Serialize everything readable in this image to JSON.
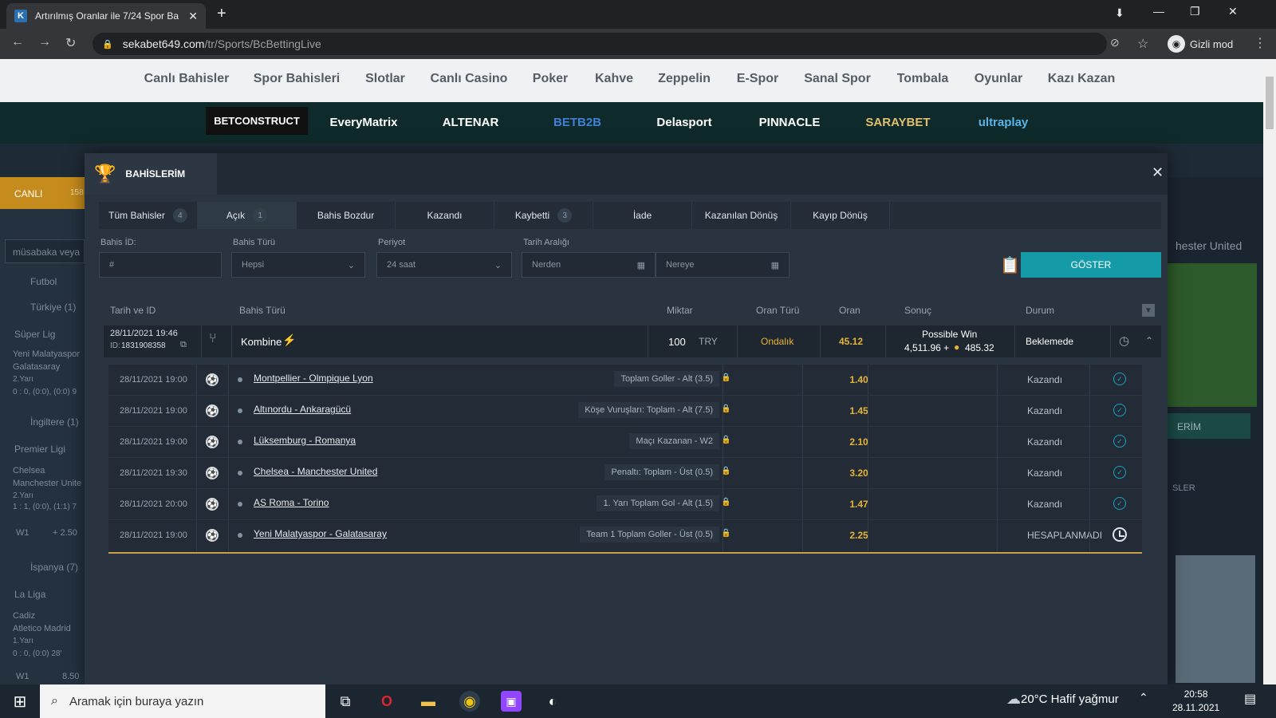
{
  "browser": {
    "tab_title": "Artırılmış Oranlar ile 7/24 Spor Ba",
    "url_domain": "sekabet649.com",
    "url_path": "/tr/Sports/BcBettingLive",
    "incognito_label": "Gizli mod"
  },
  "site_nav": [
    "Canlı Bahisler",
    "Spor Bahisleri",
    "Slotlar",
    "Canlı Casino",
    "Poker",
    "Kahve",
    "Zeppelin",
    "E-Spor",
    "Sanal Spor",
    "Tombala",
    "Oyunlar",
    "Kazı Kazan"
  ],
  "providers": [
    "BETCONSTRUCT",
    "EveryMatrix",
    "ALTENAR",
    "BETB2B",
    "Delasport",
    "PINNACLE",
    "SARAYBET",
    "ultraplay"
  ],
  "left_panel": {
    "live": "CANLI",
    "live_count": "158",
    "search_placeholder": "müsabaka veya",
    "football": "Futbol",
    "turkey": "Türkiye (1)",
    "super_lig": "Süper Lig",
    "m1a": "Yeni Malatyaspor",
    "m1b": "Galatasaray",
    "m1c": "2.Yarı",
    "m1d": "0 : 0, (0:0), (0:0) 9",
    "england": "İngiltere (1)",
    "premier": "Premier Ligi",
    "m2a": "Chelsea",
    "m2b": "Manchester Unite",
    "m2c": "2.Yarı",
    "m2d": "1 : 1, (0:0), (1:1) 7",
    "w1": "W1",
    "w1val": "+ 2.50",
    "spain": "İspanya (7)",
    "laliga": "La Liga",
    "m3a": "Cadiz",
    "m3b": "Atletico Madrid",
    "m3c": "1.Yarı",
    "m3d": "0 : 0, (0:0) 28'",
    "w1b": "W1",
    "w1bval": "8.50"
  },
  "right_panel": {
    "team": "hester United",
    "btn": "ERİM",
    "tab": "SLER"
  },
  "modal": {
    "title": "BAHİSLERİM",
    "tabs": [
      {
        "label": "Tüm Bahisler",
        "count": "4"
      },
      {
        "label": "Açık",
        "count": "1"
      },
      {
        "label": "Bahis Bozdur",
        "count": ""
      },
      {
        "label": "Kazandı",
        "count": ""
      },
      {
        "label": "Kaybetti",
        "count": "3"
      },
      {
        "label": "İade",
        "count": ""
      },
      {
        "label": "Kazanılan Dönüş",
        "count": ""
      },
      {
        "label": "Kayıp Dönüş",
        "count": ""
      }
    ],
    "filters": {
      "bet_id_label": "Bahis İD:",
      "bet_id_placeholder": "#",
      "bet_type_label": "Bahis Türü",
      "bet_type_value": "Hepsi",
      "period_label": "Periyot",
      "period_value": "24 saat",
      "date_range_label": "Tarih Aralığı",
      "from_placeholder": "Nerden",
      "to_placeholder": "Nereye",
      "show_button": "GÖSTER"
    },
    "columns": [
      "Tarih ve ID",
      "Bahis Türü",
      "Miktar",
      "Oran Türü",
      "Oran",
      "Sonuç",
      "Durum"
    ],
    "bet": {
      "date": "28/11/2021 19:46",
      "id_prefix": "ID:",
      "id": "1831908358",
      "type": "Kombine",
      "amount": "100",
      "currency": "TRY",
      "odds_type": "Ondalık",
      "odds": "45.12",
      "result_label": "Possible Win",
      "result_value": "4,511.96 +",
      "bonus": "485.32",
      "status": "Beklemede"
    },
    "legs": [
      {
        "date": "28/11/2021 19:00",
        "match": "Montpellier - Olmpique Lyon",
        "market": "Toplam Goller - Alt (3.5)",
        "odds": "1.40",
        "status": "Kazandı",
        "icon": "check"
      },
      {
        "date": "28/11/2021 19:00",
        "match": "Altınordu - Ankaragücü",
        "market": "Köşe Vuruşları: Toplam - Alt (7.5)",
        "odds": "1.45",
        "status": "Kazandı",
        "icon": "check"
      },
      {
        "date": "28/11/2021 19:00",
        "match": "Lüksemburg - Romanya",
        "market": "Maçı Kazanan - W2",
        "odds": "2.10",
        "status": "Kazandı",
        "icon": "check"
      },
      {
        "date": "28/11/2021 19:30",
        "match": "Chelsea - Manchester United",
        "market": "Penaltı: Toplam - Üst (0.5)",
        "odds": "3.20",
        "status": "Kazandı",
        "icon": "check"
      },
      {
        "date": "28/11/2021 20:00",
        "match": "AS Roma - Torino",
        "market": "1. Yarı Toplam Gol - Alt (1.5)",
        "odds": "1.47",
        "status": "Kazandı",
        "icon": "check"
      },
      {
        "date": "28/11/2021 19:00",
        "match": "Yeni Malatyaspor - Galatasaray",
        "market": "Team 1 Toplam Goller - Üst (0.5)",
        "odds": "2.25",
        "status": "HESAPLANMADI",
        "icon": "clock"
      }
    ]
  },
  "taskbar": {
    "search_placeholder": "Aramak için buraya yazın",
    "weather": "20°C  Hafif yağmur",
    "time": "20:58",
    "date": "28.11.2021"
  },
  "colors": {
    "accent": "#159ba8",
    "odds": "#e6b437",
    "modal_bg": "#2a3340"
  }
}
